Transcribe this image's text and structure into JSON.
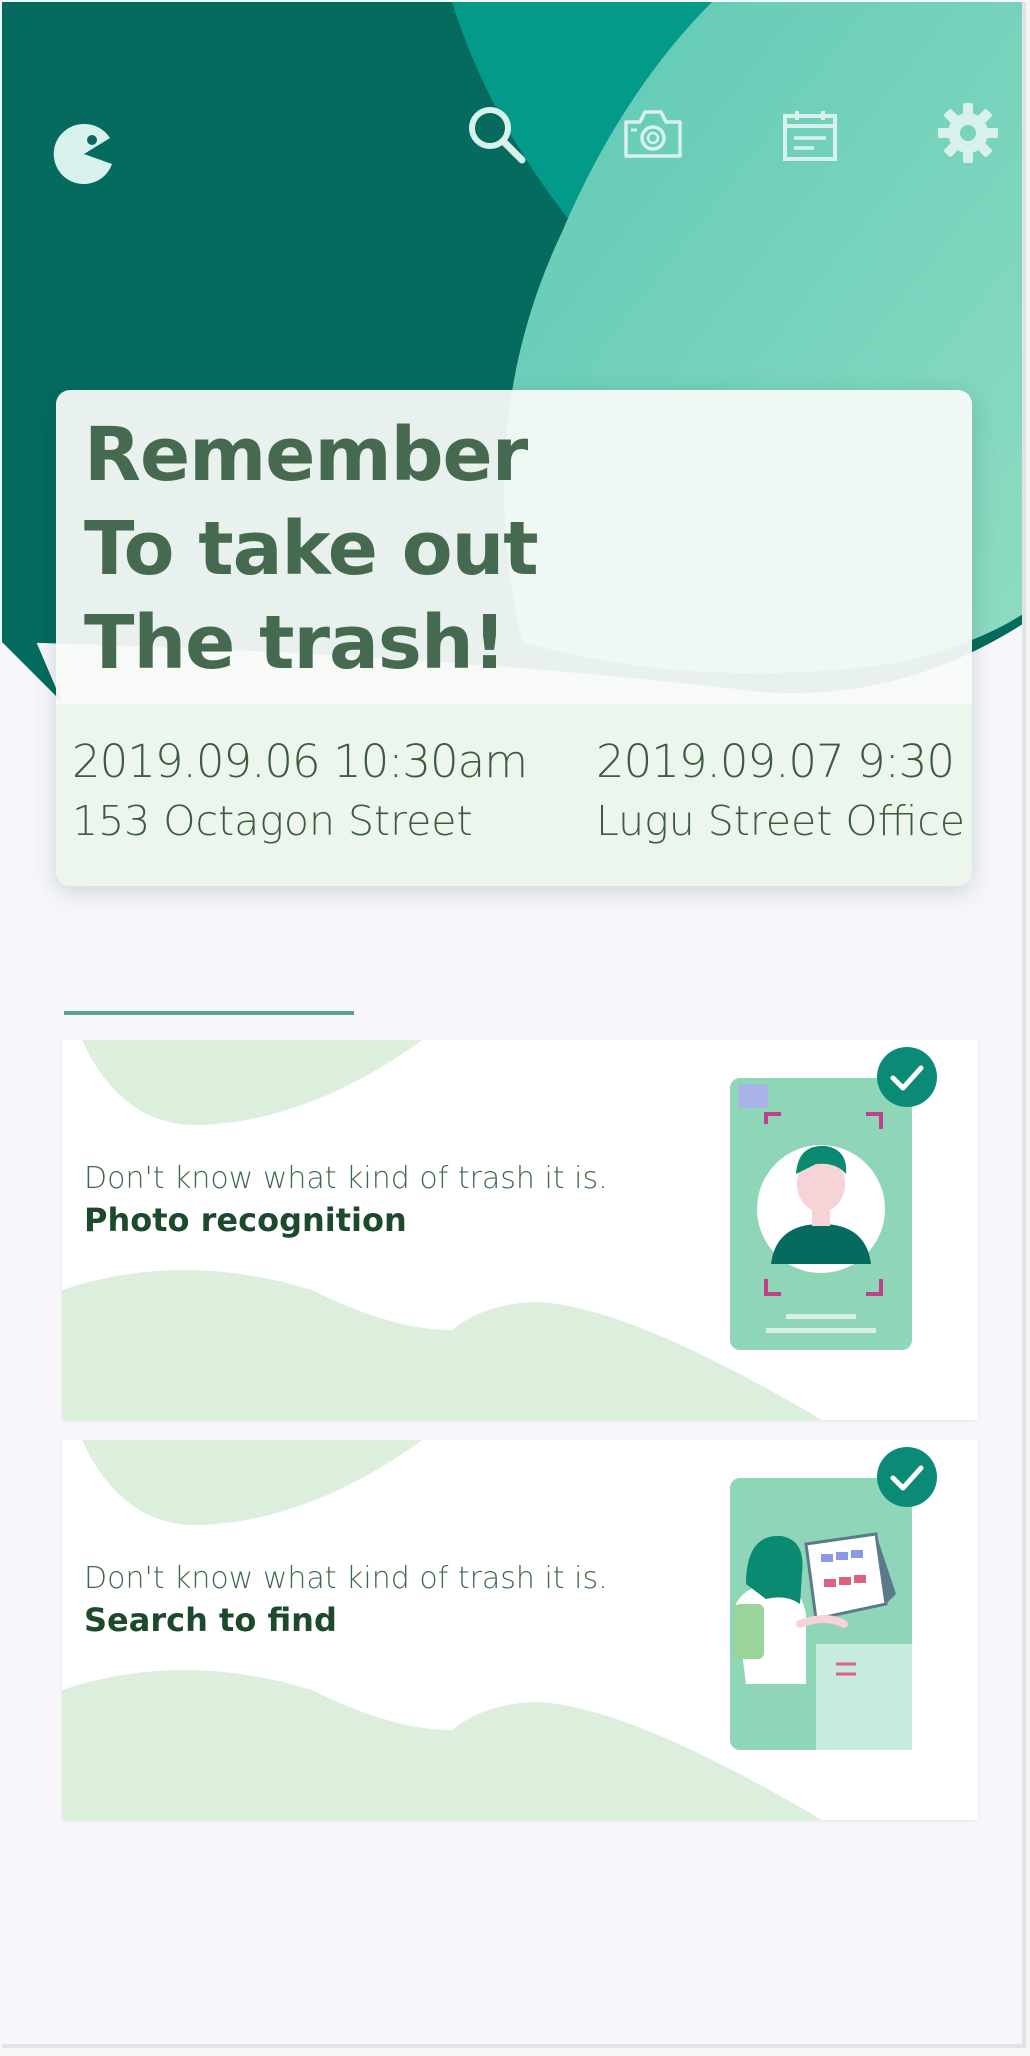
{
  "header": {
    "icons": [
      "pacman-logo-icon",
      "search-icon",
      "camera-icon",
      "calendar-icon",
      "gear-icon"
    ]
  },
  "reminder": {
    "title_lines": [
      "Remember",
      "To take out",
      "The trash!"
    ],
    "events": [
      {
        "datetime": "2019.09.06 10:30am",
        "location": "153 Octagon Street"
      },
      {
        "datetime": "2019.09.07 9:30",
        "location": "Lugu Street  Office"
      }
    ]
  },
  "features": [
    {
      "subtitle": "Don't know what kind of trash it is.",
      "label": "Photo recognition",
      "illustration": "photo-id-illustration-icon",
      "badge": "check-icon"
    },
    {
      "subtitle": "Don't know what kind of trash it is.",
      "label": "Search to find",
      "illustration": "person-at-screen-illustration-icon",
      "badge": "check-icon"
    }
  ],
  "colors": {
    "header_dark": "#046b5e",
    "header_mid": "#049a8a",
    "header_light": "#6fcdb8",
    "title_text": "#456a50",
    "accent_divider": "#5aa292",
    "card_wave": "#dcefdc",
    "check_badge": "#0b8a77"
  }
}
